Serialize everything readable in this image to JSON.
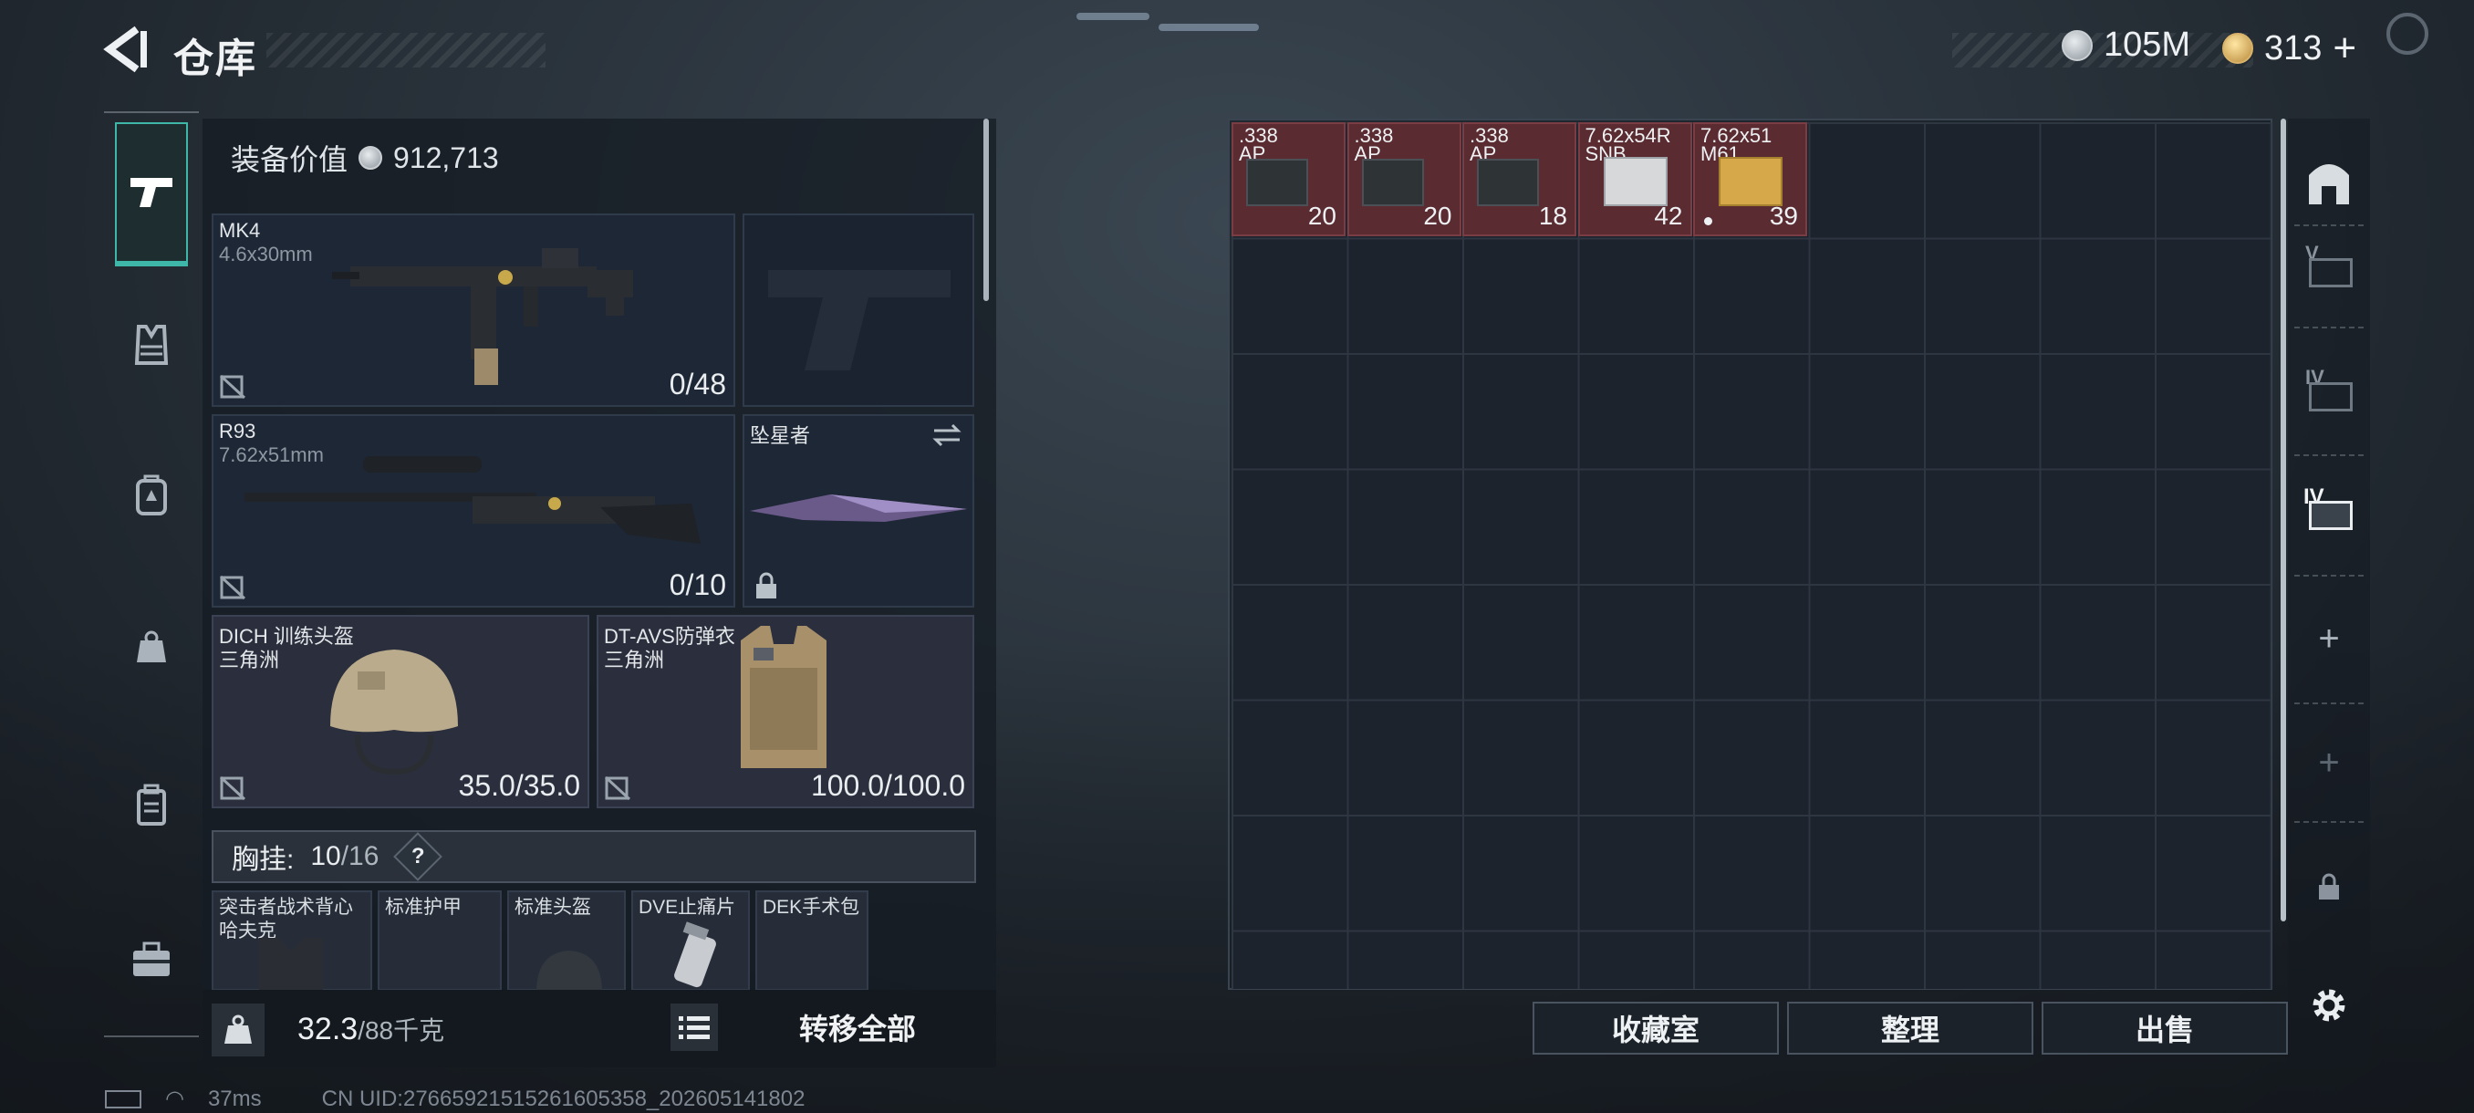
{
  "header": {
    "title": "仓库",
    "currency_coins": "105M",
    "currency_tokens": "313",
    "tokens_plus": "+"
  },
  "loadout": {
    "value_label": "装备价值",
    "value": "912,713",
    "weapons": [
      {
        "name": "MK4",
        "caliber": "4.6x30mm",
        "ammo": "0/48"
      },
      {
        "name": "R93",
        "caliber": "7.62x51mm",
        "ammo": "0/10"
      }
    ],
    "melee": {
      "name": "坠星者"
    },
    "helmet": {
      "name": "DICH 训练头盔",
      "faction": "三角洲",
      "durability": "35.0/35.0"
    },
    "armor": {
      "name": "DT-AVS防弹衣",
      "faction": "三角洲",
      "durability": "100.0/100.0"
    },
    "chest_rig": {
      "label": "胸挂:",
      "used": "10",
      "capacity": "/16",
      "help": "?"
    },
    "chest_items": [
      {
        "label": "突击者战术背心\n哈夫克"
      },
      {
        "label": "标准护甲"
      },
      {
        "label": "标准头盔"
      },
      {
        "label": "DVE止痛片"
      },
      {
        "label": "DEK手术包"
      }
    ],
    "weight": "32.3",
    "weight_max": "/88千克",
    "transfer_all": "转移全部"
  },
  "storage": {
    "items": [
      {
        "line1": ".338",
        "line2": "AP",
        "qty": "20"
      },
      {
        "line1": ".338",
        "line2": "AP",
        "qty": "20"
      },
      {
        "line1": ".338",
        "line2": "AP",
        "qty": "18"
      },
      {
        "line1": "7.62x54R",
        "line2": "SNB",
        "qty": "42"
      },
      {
        "line1": "7.62x51",
        "line2": "M61",
        "qty": "39"
      }
    ],
    "buttons": {
      "collection": "收藏室",
      "organize": "整理",
      "sell": "出售"
    }
  },
  "right_tabs": [
    "V",
    "IV",
    "IV"
  ],
  "status": {
    "ping": "37ms",
    "uid": "CN UID:27665921515261605358_202605141802"
  },
  "colors": {
    "accent": "#3fb7a8",
    "item_bg": "#5a2b30",
    "panel": "#1c232d"
  }
}
